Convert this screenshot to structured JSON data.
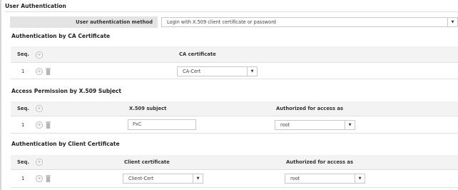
{
  "user_auth": {
    "title": "User Authentication",
    "method_label": "User authentication method",
    "method_value": "Login with X.509 client certificate or password"
  },
  "ca_section": {
    "title": "Authentication by CA Certificate",
    "col_seq": "Seq.",
    "col_cert": "CA certificate",
    "rows": [
      {
        "seq": "1",
        "cert": "CA-Cert"
      }
    ]
  },
  "subject_section": {
    "title": "Access Permission by X.509 Subject",
    "col_seq": "Seq.",
    "col_subject": "X.509 subject",
    "col_access": "Authorized for access as",
    "rows": [
      {
        "seq": "1",
        "subject": "PxC",
        "access": "root"
      }
    ]
  },
  "client_section": {
    "title": "Authentication by Client Certificate",
    "col_seq": "Seq.",
    "col_cert": "Client certificate",
    "col_access": "Authorized for access as",
    "rows": [
      {
        "seq": "1",
        "cert": "Client-Cert",
        "access": "root"
      }
    ]
  },
  "icons": {
    "add": "plus-circle-icon",
    "delete": "trash-icon",
    "dropdown": "chevron-down-icon"
  }
}
